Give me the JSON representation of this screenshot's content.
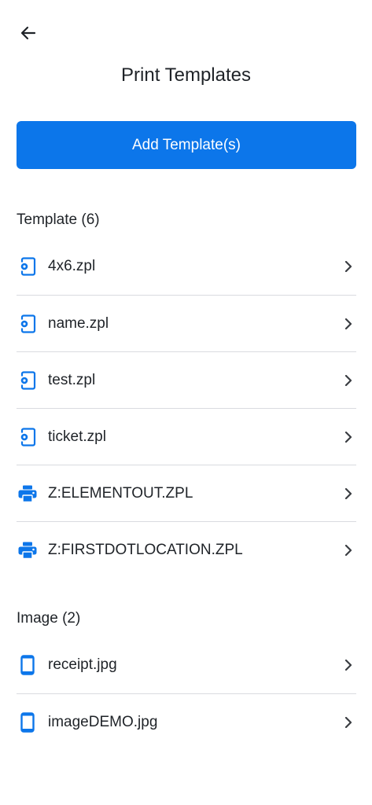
{
  "header": {
    "title": "Print Templates",
    "back_icon": "arrow-left-icon"
  },
  "actions": {
    "add_label": "Add Template(s)",
    "accent_color": "#0c76ea"
  },
  "templates": {
    "header": "Template (6)",
    "items": [
      {
        "label": "4x6.zpl",
        "icon": "phone-gear-icon"
      },
      {
        "label": "name.zpl",
        "icon": "phone-gear-icon"
      },
      {
        "label": "test.zpl",
        "icon": "phone-gear-icon"
      },
      {
        "label": "ticket.zpl",
        "icon": "phone-gear-icon"
      },
      {
        "label": "Z:ELEMENTOUT.ZPL",
        "icon": "printer-icon"
      },
      {
        "label": "Z:FIRSTDOTLOCATION.ZPL",
        "icon": "printer-icon"
      }
    ]
  },
  "images": {
    "header": "Image (2)",
    "items": [
      {
        "label": "receipt.jpg",
        "icon": "phone-icon"
      },
      {
        "label": "imageDEMO.jpg",
        "icon": "phone-icon"
      }
    ]
  }
}
